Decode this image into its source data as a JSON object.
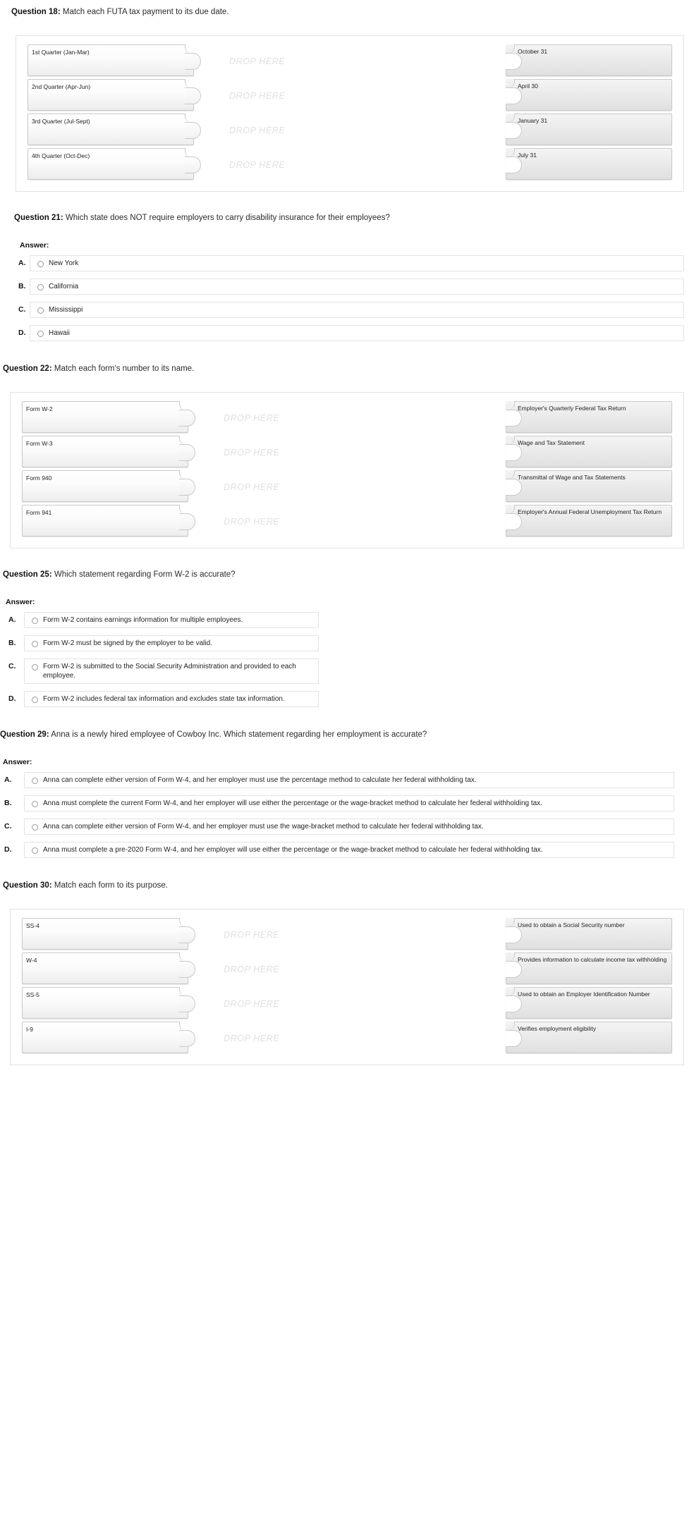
{
  "drop_placeholder": "DROP HERE",
  "answer_heading": "Answer:",
  "letters": [
    "A.",
    "B.",
    "C.",
    "D."
  ],
  "questions": [
    {
      "id": "q18",
      "number": "Question 18:",
      "prompt": "Match each FUTA tax payment to its due date.",
      "type": "match",
      "left": [
        "1st Quarter (Jan-Mar)",
        "2nd Quarter (Apr-Jun)",
        "3rd Quarter (Jul-Sept)",
        "4th Quarter (Oct-Dec)"
      ],
      "right": [
        "October 31",
        "April 30",
        "January 31",
        "July 31"
      ]
    },
    {
      "id": "q21",
      "number": "Question 21:",
      "prompt": "Which state does NOT require employers to carry disability insurance for their employees?",
      "type": "choice",
      "options": [
        "New York",
        "California",
        "Mississippi",
        "Hawaii"
      ]
    },
    {
      "id": "q22",
      "number": "Question 22:",
      "prompt": "Match each form's number to its name.",
      "type": "match",
      "left": [
        "Form W-2",
        "Form W-3",
        "Form 940",
        "Form 941"
      ],
      "right": [
        "Employer's Quarterly Federal Tax Return",
        "Wage and Tax Statement",
        "Transmittal of Wage and Tax Statements",
        "Employer's Annual Federal Unemployment Tax Return"
      ]
    },
    {
      "id": "q25",
      "number": "Question 25:",
      "prompt": "Which statement regarding Form W-2 is accurate?",
      "type": "choice",
      "options": [
        "Form W-2 contains earnings information for multiple employees.",
        "Form W-2 must be signed by the employer to be valid.",
        "Form W-2 is submitted to the Social Security Administration and provided to each employee.",
        "Form W-2 includes federal tax information and excludes state tax information."
      ]
    },
    {
      "id": "q29",
      "number": "Question 29:",
      "prompt": "Anna is a newly hired employee of Cowboy Inc. Which statement regarding her employment is accurate?",
      "type": "choice",
      "options": [
        "Anna can complete either version of Form W-4, and her employer must use the percentage method to calculate her federal withholding tax.",
        "Anna must complete the current Form W-4, and her employer will use either the percentage or the wage-bracket method to calculate her federal withholding tax.",
        "Anna can complete either version of Form W-4, and her employer must use the wage-bracket method to calculate her federal withholding tax.",
        "Anna must complete a pre-2020 Form W-4, and her employer will use either the percentage or the wage-bracket method to calculate her federal withholding tax."
      ]
    },
    {
      "id": "q30",
      "number": "Question 30:",
      "prompt": "Match each form to its purpose.",
      "type": "match",
      "left": [
        "SS-4",
        "W-4",
        "SS-5",
        "I-9"
      ],
      "right": [
        "Used to obtain a Social Security number",
        "Provides information to calculate income tax withholding",
        "Used to obtain an Employer Identification Number",
        "Verifies employment eligibility"
      ]
    }
  ]
}
